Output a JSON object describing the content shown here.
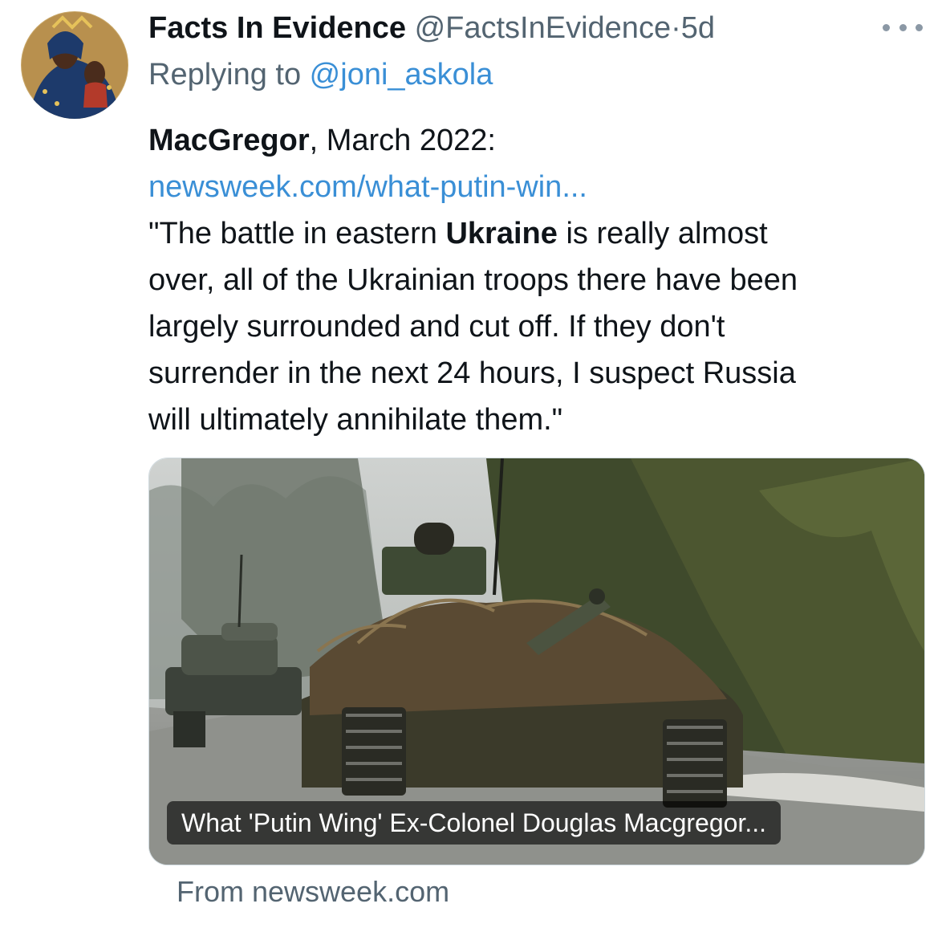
{
  "tweet": {
    "author": {
      "name": "Facts In Evidence",
      "handle": "@FactsInEvidence",
      "separator": "·",
      "time": "5d"
    },
    "reply": {
      "prefix": "Replying to ",
      "to_handle": "@joni_askola"
    },
    "body": {
      "line1_bold": "MacGregor",
      "line1_rest": ", March 2022:",
      "link": "newsweek.com/what-putin-win...",
      "line3_pre": "\"The battle in eastern ",
      "line3_bold": "Ukraine",
      "line3_post": " is really almost",
      "line4": "over, all of the Ukrainian troops there have been",
      "line5": "largely surrounded and cut off. If they don't",
      "line6": "surrender in the next 24 hours, I suspect Russia",
      "line7": "will ultimately annihilate them.\""
    },
    "card": {
      "caption": "What 'Putin Wing' Ex-Colonel Douglas Macgregor...",
      "source": "From newsweek.com"
    },
    "icons": {
      "more": "more-horizontal-icon",
      "avatar": "icon-painting-avatar"
    },
    "colors": {
      "link": "#3a8fd6",
      "secondary_text": "#536471"
    }
  }
}
